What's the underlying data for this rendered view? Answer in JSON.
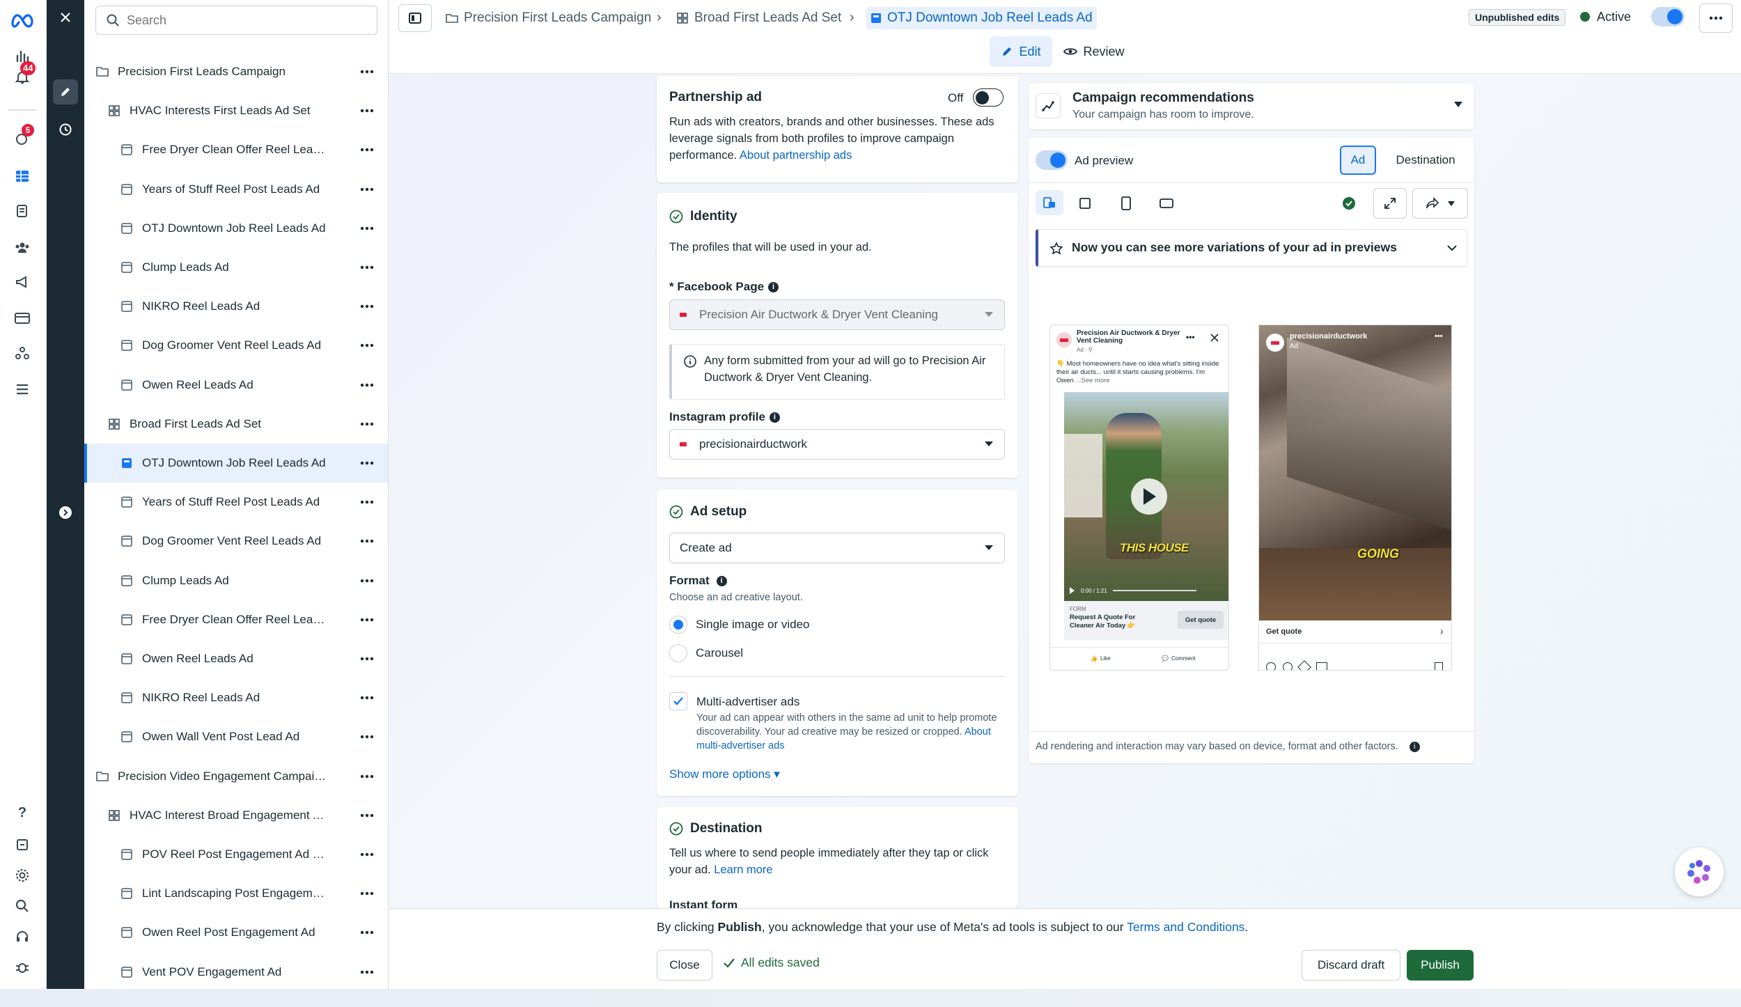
{
  "rail": {
    "notif_badge": "44",
    "alert_badge": "5",
    "help_label": "?"
  },
  "search": {
    "placeholder": "Search"
  },
  "tree": [
    {
      "label": "Precision First Leads Campaign",
      "level": 0,
      "kind": "campaign"
    },
    {
      "label": "HVAC Interests First Leads Ad Set",
      "level": 1,
      "kind": "adset"
    },
    {
      "label": "Free Dryer Clean Offer Reel Leads ...",
      "level": 2,
      "kind": "ad"
    },
    {
      "label": "Years of Stuff Reel Post Leads Ad",
      "level": 2,
      "kind": "ad"
    },
    {
      "label": "OTJ Downtown Job Reel Leads Ad",
      "level": 2,
      "kind": "ad"
    },
    {
      "label": "Clump Leads Ad",
      "level": 2,
      "kind": "ad"
    },
    {
      "label": "NIKRO Reel Leads Ad",
      "level": 2,
      "kind": "ad"
    },
    {
      "label": "Dog Groomer Vent Reel Leads Ad",
      "level": 2,
      "kind": "ad"
    },
    {
      "label": "Owen Reel Leads Ad",
      "level": 2,
      "kind": "ad"
    },
    {
      "label": "Broad First Leads Ad Set",
      "level": 1,
      "kind": "adset"
    },
    {
      "label": "OTJ Downtown Job Reel Leads Ad",
      "level": 2,
      "kind": "ad",
      "selected": true
    },
    {
      "label": "Years of Stuff Reel Post Leads Ad",
      "level": 2,
      "kind": "ad"
    },
    {
      "label": "Dog Groomer Vent Reel Leads Ad",
      "level": 2,
      "kind": "ad"
    },
    {
      "label": "Clump Leads Ad",
      "level": 2,
      "kind": "ad"
    },
    {
      "label": "Free Dryer Clean Offer Reel Leads ...",
      "level": 2,
      "kind": "ad"
    },
    {
      "label": "Owen Reel Leads Ad",
      "level": 2,
      "kind": "ad"
    },
    {
      "label": "NIKRO Reel Leads Ad",
      "level": 2,
      "kind": "ad"
    },
    {
      "label": "Owen Wall Vent Post Lead Ad",
      "level": 2,
      "kind": "ad"
    },
    {
      "label": "Precision Video Engagement Campaign",
      "level": 0,
      "kind": "campaign"
    },
    {
      "label": "HVAC Interest Broad Engagement A...",
      "level": 1,
      "kind": "adset"
    },
    {
      "label": "POV Reel Post Engagement Ad - ...",
      "level": 2,
      "kind": "ad"
    },
    {
      "label": "Lint Landscaping Post Engageme...",
      "level": 2,
      "kind": "ad"
    },
    {
      "label": "Owen Reel Post Engagement Ad",
      "level": 2,
      "kind": "ad"
    },
    {
      "label": "Vent POV Engagement Ad",
      "level": 2,
      "kind": "ad"
    }
  ],
  "breadcrumb": {
    "campaign": "Precision First Leads Campaign",
    "adset": "Broad First Leads Ad Set",
    "ad": "OTJ Downtown Job Reel Leads Ad"
  },
  "header": {
    "unpublished": "Unpublished edits",
    "status": "Active",
    "edit_tab": "Edit",
    "review_tab": "Review"
  },
  "partnership": {
    "title": "Partnership ad",
    "toggle_label": "Off",
    "text": "Run ads with creators, brands and other businesses. These ads leverage signals from both profiles to improve campaign performance.",
    "link": "About partnership ads"
  },
  "identity": {
    "title": "Identity",
    "desc": "The profiles that will be used in your ad.",
    "fb_label": "* Facebook Page",
    "fb_value": "Precision Air Ductwork & Dryer Vent Cleaning",
    "notice": "Any form submitted from your ad will go to Precision Air Ductwork & Dryer Vent Cleaning.",
    "ig_label": "Instagram profile",
    "ig_value": "precisionairductwork"
  },
  "ad_setup": {
    "title": "Ad setup",
    "create_value": "Create ad",
    "format_label": "Format",
    "format_desc": "Choose an ad creative layout.",
    "opt1": "Single image or video",
    "opt2": "Carousel",
    "multi_title": "Multi-advertiser ads",
    "multi_desc": "Your ad can appear with others in the same ad unit to help promote discoverability. Your ad creative may be resized or cropped.",
    "multi_link": "About multi-advertiser ads",
    "more_options": "Show more options ▾"
  },
  "destination": {
    "title": "Destination",
    "text": "Tell us where to send people immediately after they tap or click your ad.",
    "link": "Learn more",
    "partial": "Instant form"
  },
  "recommendations": {
    "title": "Campaign recommendations",
    "subtitle": "Your campaign has room to improve."
  },
  "preview": {
    "toggle_label": "Ad preview",
    "tab_ad": "Ad",
    "tab_destination": "Destination",
    "variations_text": "Now you can see more variations of your ad in previews",
    "disclaimer": "Ad rendering and interaction may vary based on device, format and other factors."
  },
  "fb_preview": {
    "page": "Precision Air Ductwork & Dryer Vent Cleaning",
    "sponsored": "Ad · ⚲",
    "body": "👇 Most homeowners have no idea what's sitting inside their air ducts... until it starts causing problems. I'm Owen",
    "see_more": "...See more",
    "caption": "THIS HOUSE",
    "time": "0:00 / 1:21",
    "form_label": "FORM",
    "cta_title": "Request A Quote For Cleaner Air Today 👉",
    "cta": "Get quote",
    "like": "Like",
    "comment": "Comment"
  },
  "ig_preview": {
    "handle": "precisionairductwork",
    "sponsored": "Ad",
    "caption": "GOING",
    "cta": "Get quote"
  },
  "bottom": {
    "consent_pre": "By clicking ",
    "consent_bold": "Publish",
    "consent_mid": ", you acknowledge that your use of Meta's ad tools is subject to our ",
    "consent_link": "Terms and Conditions",
    "consent_end": ".",
    "close": "Close",
    "saved": "All edits saved",
    "discard": "Discard draft",
    "publish": "Publish"
  },
  "colors": {
    "accent": "#1877f2",
    "publish": "#1e6a3b",
    "dark_strip": "#1c2b33",
    "active_dot": "#31a24c"
  }
}
